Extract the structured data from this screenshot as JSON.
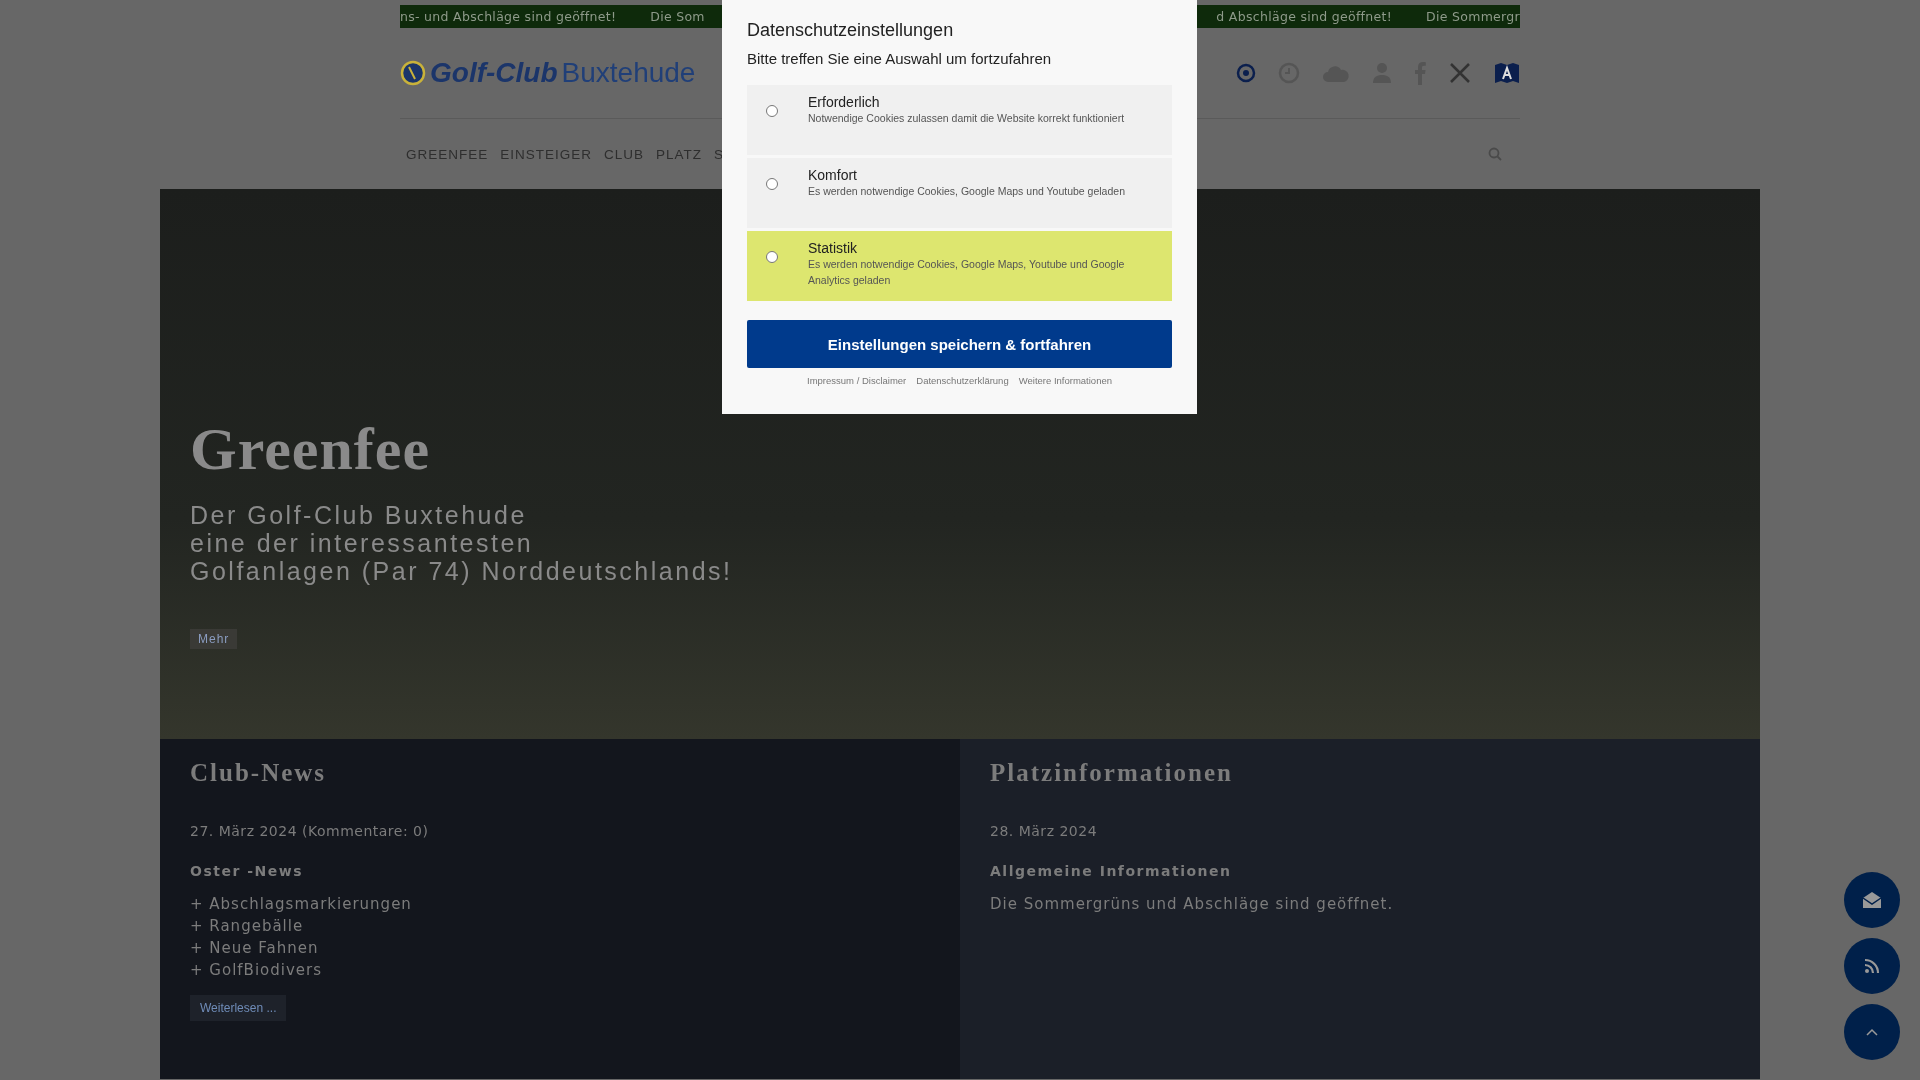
{
  "ticker": {
    "left": [
      "ns- und Abschläge sind geöffnet!",
      "Die Som"
    ],
    "right": [
      "d Abschläge sind geöffnet!",
      "Die Sommergr"
    ]
  },
  "header": {
    "logo": {
      "bold": "Golf-Club",
      "light": "Buxtehude"
    },
    "icons": [
      {
        "kind": "target"
      },
      {
        "kind": "clock"
      },
      {
        "kind": "cloud"
      },
      {
        "kind": "user"
      },
      {
        "kind": "facebook"
      },
      {
        "kind": "x"
      },
      {
        "kind": "accessibility"
      }
    ]
  },
  "nav": {
    "items": [
      "GREENFEE",
      "EINSTEIGER",
      "CLUB",
      "PLATZ",
      "S"
    ]
  },
  "hero": {
    "title": "Greenfee",
    "lines": [
      "Der Golf-Club Buxtehude",
      "eine der interessantesten",
      "Golfanlagen (Par 74) Norddeutschlands!"
    ],
    "button": "Mehr"
  },
  "news": [
    {
      "title": "Club-News",
      "date": "27. März 2024 (Kommentare: 0)",
      "subtitle": "Oster -News",
      "lines": [
        "+ Abschlagsmarkierungen",
        "+ Rangebälle",
        "+ Neue Fahnen",
        "+ GolfBiodivers"
      ],
      "button": "Weiterlesen ..."
    },
    {
      "title": "Platzinformationen",
      "date": "28. März 2024",
      "subtitle": "Allgemeine Informationen",
      "lines": [
        "Die Sommergrüns und Abschläge sind geöffnet."
      ]
    }
  ],
  "float_buttons": [
    {
      "kind": "mail"
    },
    {
      "kind": "rss"
    },
    {
      "kind": "up"
    }
  ],
  "privacy_dialog": {
    "title": "Datenschutzeinstellungen",
    "subtitle": "Bitte treffen Sie eine Auswahl um fortzufahren",
    "options": [
      {
        "label": "Erforderlich",
        "description": "Notwendige Cookies zulassen damit die Website korrekt funktioniert",
        "checked": false,
        "highlighted": false
      },
      {
        "label": "Komfort",
        "description": "Es werden notwendige Cookies, Google Maps und Youtube geladen",
        "checked": false,
        "highlighted": false
      },
      {
        "label": "Statistik",
        "description": "Es werden notwendige Cookies, Google Maps, Youtube und Google Analytics geladen",
        "checked": false,
        "highlighted": true
      }
    ],
    "button": "Einstellungen speichern & fortfahren",
    "links": [
      "Impressum / Disclaimer",
      "Datenschutzerklärung",
      "Weitere Informationen"
    ]
  }
}
